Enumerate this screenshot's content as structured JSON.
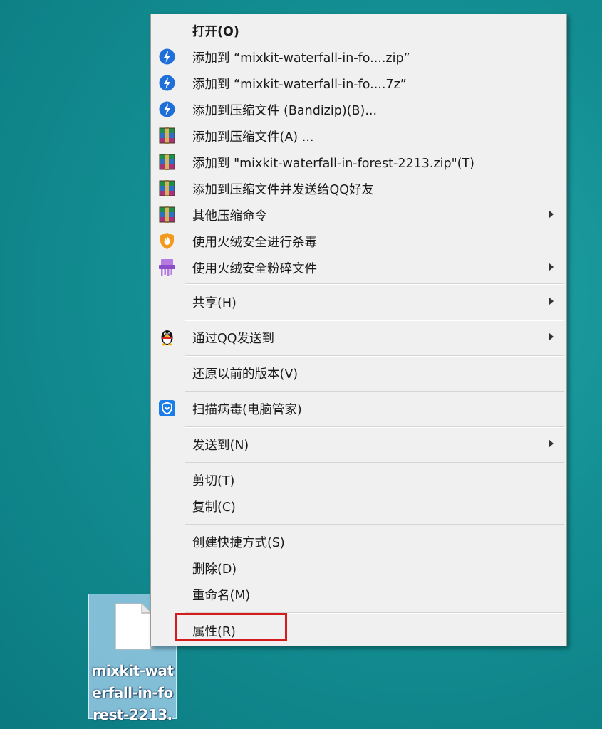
{
  "menu": {
    "items": [
      {
        "label": "打开(O)"
      },
      {
        "label": "添加到 “mixkit-waterfall-in-fo....zip”"
      },
      {
        "label": "添加到 “mixkit-waterfall-in-fo....7z”"
      },
      {
        "label": "添加到压缩文件 (Bandizip)(B)..."
      },
      {
        "label": "添加到压缩文件(A) ..."
      },
      {
        "label": "添加到 \"mixkit-waterfall-in-forest-2213.zip\"(T)"
      },
      {
        "label": "添加到压缩文件并发送给QQ好友"
      },
      {
        "label": "其他压缩命令"
      },
      {
        "label": "使用火绒安全进行杀毒"
      },
      {
        "label": "使用火绒安全粉碎文件"
      },
      {
        "label": "共享(H)"
      },
      {
        "label": "通过QQ发送到"
      },
      {
        "label": "还原以前的版本(V)"
      },
      {
        "label": "扫描病毒(电脑管家)"
      },
      {
        "label": "发送到(N)"
      },
      {
        "label": "剪切(T)"
      },
      {
        "label": "复制(C)"
      },
      {
        "label": "创建快捷方式(S)"
      },
      {
        "label": "删除(D)"
      },
      {
        "label": "重命名(M)"
      },
      {
        "label": "属性(R)"
      }
    ]
  },
  "desktop": {
    "file_label": "mixkit-waterfall-in-forest-2213."
  },
  "colors": {
    "highlight_border": "#d41c1c",
    "bandizip_blue": "#1f6fd8",
    "huorong_orange": "#f29a1f"
  }
}
